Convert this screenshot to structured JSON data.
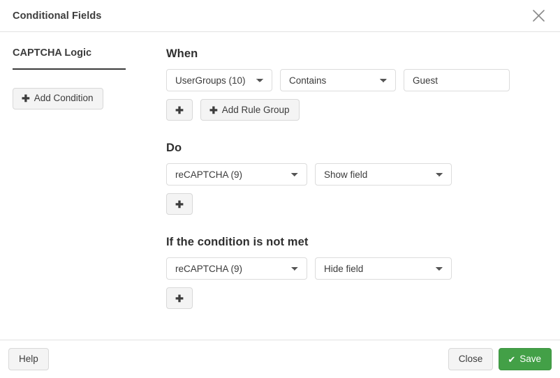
{
  "header": {
    "title": "Conditional Fields",
    "close_icon": "close-icon"
  },
  "sidebar": {
    "tab": {
      "label": "CAPTCHA Logic"
    },
    "add_condition": {
      "icon": "plus-icon",
      "label": "Add Condition"
    }
  },
  "main": {
    "when": {
      "title": "When",
      "field_select": {
        "value": "UserGroups (10)",
        "options": [
          "UserGroups (10)"
        ]
      },
      "operator_select": {
        "value": "Contains",
        "options": [
          "Contains"
        ]
      },
      "value_input": {
        "value": "Guest",
        "placeholder": ""
      },
      "add_rule_button": {
        "icon": "plus-icon",
        "label": ""
      },
      "add_rule_group_button": {
        "icon": "plus-icon",
        "label": "Add Rule Group"
      }
    },
    "do": {
      "title": "Do",
      "field_select": {
        "value": "reCAPTCHA (9)",
        "options": [
          "reCAPTCHA (9)"
        ]
      },
      "action_select": {
        "value": "Show field",
        "options": [
          "Show field"
        ]
      },
      "add_action_button": {
        "icon": "plus-icon",
        "label": ""
      }
    },
    "otherwise": {
      "title": "If the condition is not met",
      "field_select": {
        "value": "reCAPTCHA (9)",
        "options": [
          "reCAPTCHA (9)"
        ]
      },
      "action_select": {
        "value": "Hide field",
        "options": [
          "Hide field"
        ]
      },
      "add_action_button": {
        "icon": "plus-icon",
        "label": ""
      }
    }
  },
  "footer": {
    "help_label": "Help",
    "close_label": "Close",
    "save_label": "Save",
    "save_icon": "check-icon"
  },
  "colors": {
    "save_green": "#43a047",
    "border": "#dcdcdc",
    "button_bg": "#f4f4f4",
    "text": "#3c3c3c"
  }
}
